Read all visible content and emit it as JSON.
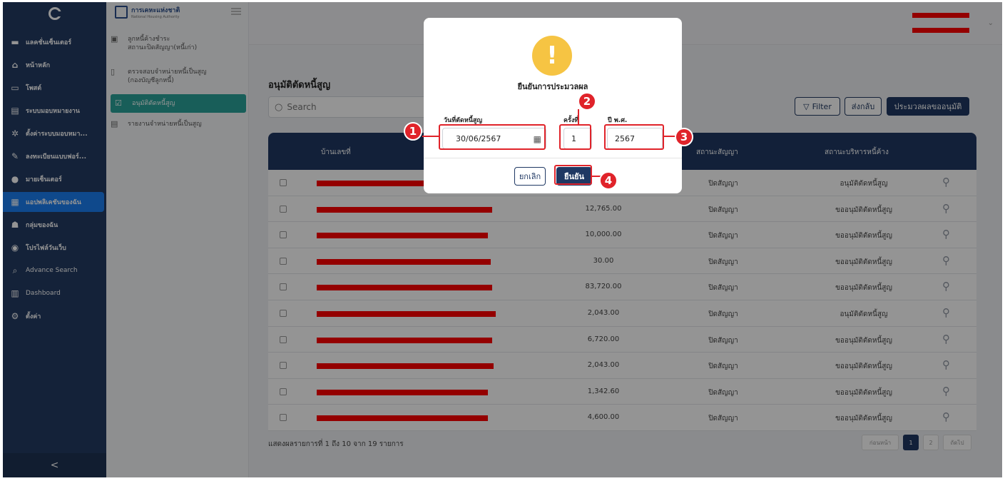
{
  "sidebar": {
    "items": [
      {
        "label": "แลคชั่นเซ็นเตอร์",
        "icon": "inbox-icon"
      },
      {
        "label": "หน้าหลัก",
        "icon": "home-icon"
      },
      {
        "label": "โพสต์",
        "icon": "post-icon"
      },
      {
        "label": "ระบบมอบหมายงาน",
        "icon": "document-icon"
      },
      {
        "label": "ตั้งค่าระบบมอบหมา...",
        "icon": "settings-icon"
      },
      {
        "label": "ลงทะเบียนแบบฟอร์...",
        "icon": "form-icon"
      },
      {
        "label": "มายเซ็นเตอร์",
        "icon": "user-icon"
      },
      {
        "label": "แอปพลิเคชันของฉัน",
        "icon": "apps-icon"
      },
      {
        "label": "กลุ่มของฉัน",
        "icon": "group-icon"
      },
      {
        "label": "โปรไฟล์วันเว็บ",
        "icon": "profile-icon"
      },
      {
        "label": "Advance Search",
        "icon": "search-icon"
      },
      {
        "label": "Dashboard",
        "icon": "chart-icon"
      },
      {
        "label": "ตั้งค่า",
        "icon": "gear-icon"
      }
    ],
    "collapse": "<"
  },
  "brand": {
    "title": "การเคหะแห่งชาติ",
    "subtitle": "National Housing Authority"
  },
  "subnav": {
    "items": [
      {
        "label": "ลูกหนี้ค้างชำระ\nสถานะปิดสัญญา(หนี้เก่า)",
        "icon": "calendar-icon"
      },
      {
        "label": "ตรวจสอบจำหน่ายหนี้เป็นสูญ\n(กองบัญชีลูกหนี้)",
        "icon": "receipt-icon"
      },
      {
        "label": "อนุมัติตัดหนี้สูญ",
        "icon": "check-doc-icon"
      },
      {
        "label": "รายงานจำหน่ายหนี้เป็นสูญ",
        "icon": "table-icon"
      }
    ]
  },
  "page": {
    "title": "อนุมัติตัดหนี้สูญ",
    "search_placeholder": "Search",
    "filter": "Filter",
    "send_back": "ส่งกลับ",
    "process": "ประมวลผลขออนุมัติ"
  },
  "table": {
    "headers": {
      "house_no": "บ้านเลขที่",
      "contract_status": "สถานะสัญญา",
      "debt_status": "สถานะบริหารหนี้ค้าง"
    },
    "rows": [
      {
        "amount": "",
        "status": "ปิดสัญญา",
        "debt": "อนุมัติตัดหนี้สูญ"
      },
      {
        "amount": "12,765.00",
        "status": "ปิดสัญญา",
        "debt": "ขออนุมัติตัดหนี้สูญ"
      },
      {
        "amount": "10,000.00",
        "status": "ปิดสัญญา",
        "debt": "ขออนุมัติตัดหนี้สูญ"
      },
      {
        "amount": "30.00",
        "status": "ปิดสัญญา",
        "debt": "ขออนุมัติตัดหนี้สูญ"
      },
      {
        "amount": "83,720.00",
        "status": "ปิดสัญญา",
        "debt": "ขออนุมัติตัดหนี้สูญ"
      },
      {
        "amount": "2,043.00",
        "status": "ปิดสัญญา",
        "debt": "อนุมัติตัดหนี้สูญ"
      },
      {
        "amount": "6,720.00",
        "status": "ปิดสัญญา",
        "debt": "ขออนุมัติตัดหนี้สูญ"
      },
      {
        "amount": "2,043.00",
        "status": "ปิดสัญญา",
        "debt": "ขออนุมัติตัดหนี้สูญ"
      },
      {
        "amount": "1,342.60",
        "status": "ปิดสัญญา",
        "debt": "ขออนุมัติตัดหนี้สูญ"
      },
      {
        "amount": "4,600.00",
        "status": "ปิดสัญญา",
        "debt": "ขออนุมัติตัดหนี้สูญ"
      }
    ],
    "summary": "แสดงผลรายการที่ 1 ถึง 10 จาก 19 รายการ",
    "pagination": {
      "prev": "ก่อนหน้า",
      "page1": "1",
      "page2": "2",
      "next": "ถัดไป"
    }
  },
  "modal": {
    "title": "ยืนยันการประมวลผล",
    "date_label": "วันที่ตัดหนี้สูญ",
    "date_value": "30/06/2567",
    "round_label": "ครั้งที่",
    "round_value": "1",
    "year_label": "ปี พ.ศ.",
    "year_value": "2567",
    "cancel": "ยกเลิก",
    "confirm": "ยืนยัน"
  },
  "annotations": [
    "1",
    "2",
    "3",
    "4"
  ],
  "colors": {
    "navy": "#1f3863",
    "sidebar": "#243b62",
    "accent_teal": "#2aa39a",
    "accent_blue": "#1b7ff2",
    "annotation_red": "#e0232a",
    "warning": "#f6c443"
  }
}
